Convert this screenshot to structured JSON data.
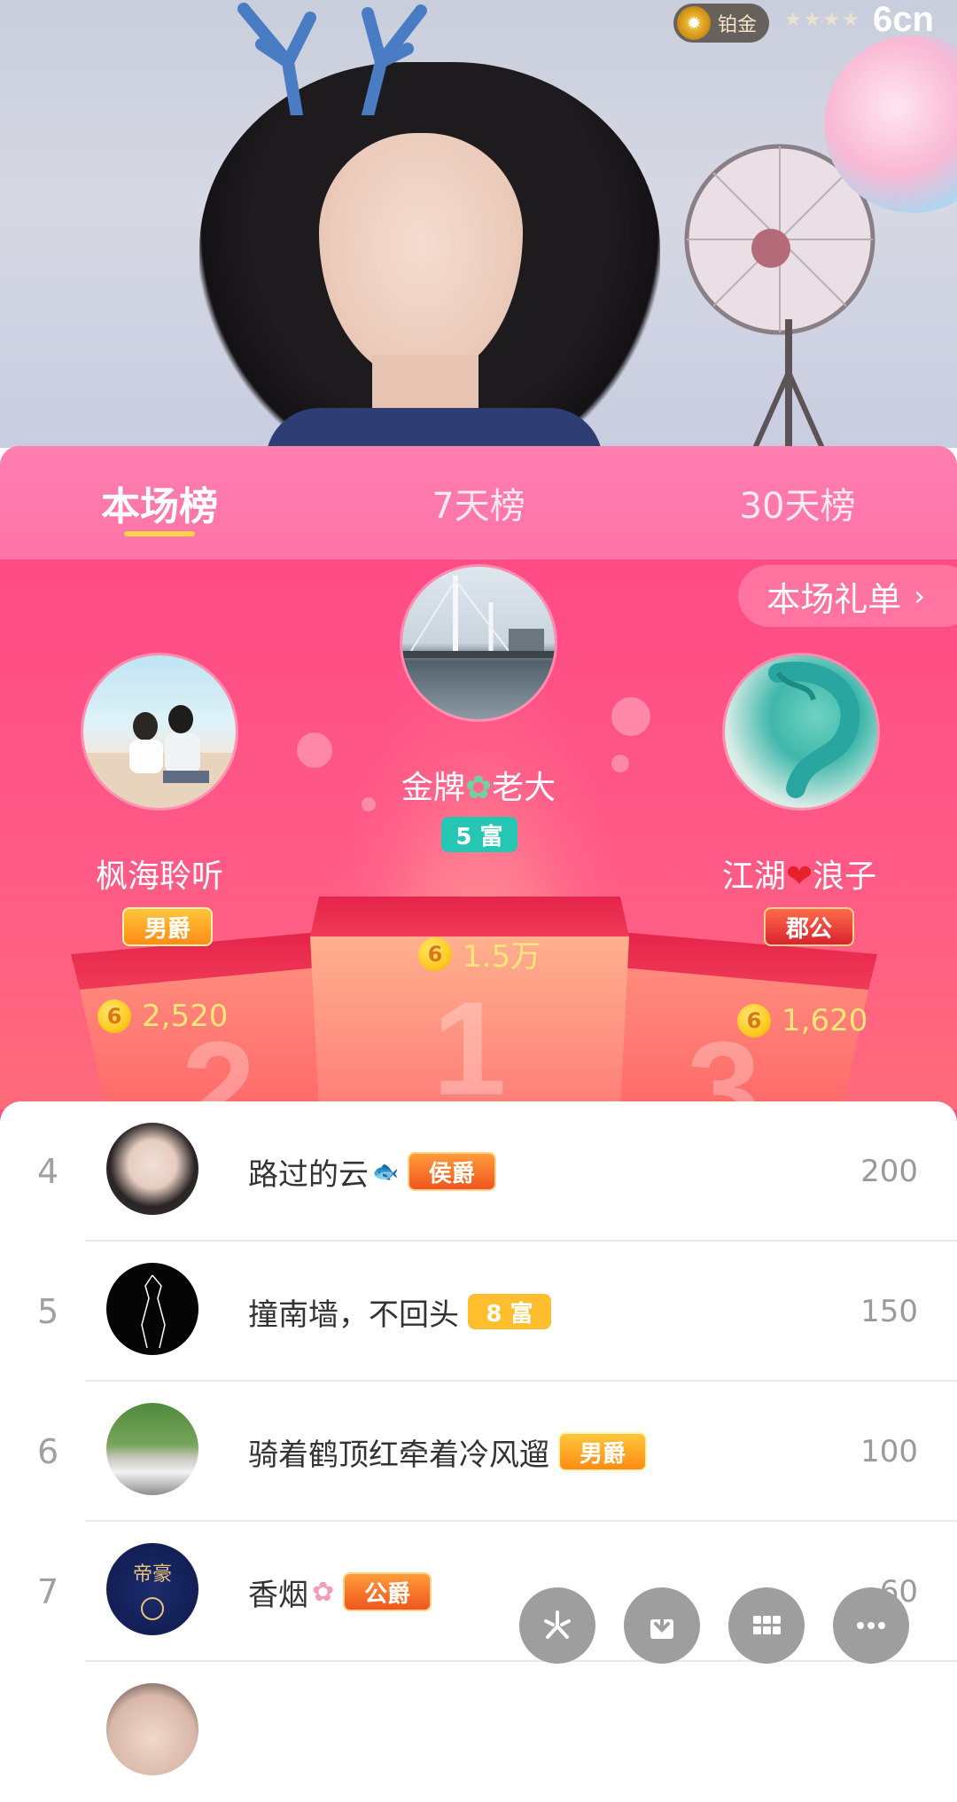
{
  "header": {
    "level_label": "铂金",
    "logo_text": "6cn"
  },
  "tabs": [
    "本场榜",
    "7天榜",
    "30天榜"
  ],
  "gift_list_button": "本场礼单",
  "podium": {
    "first": {
      "name": "金牌",
      "name_suffix": "老大",
      "tag": "5 富",
      "score": "1.5万"
    },
    "second": {
      "name": "枫海聆听",
      "tag": "男爵",
      "score": "2,520"
    },
    "third": {
      "name": "江湖",
      "name_suffix": "浪子",
      "tag": "郡公",
      "score": "1,620"
    }
  },
  "list": [
    {
      "rank": "4",
      "name": "路过的云",
      "tag": "侯爵",
      "score": "200"
    },
    {
      "rank": "5",
      "name": "撞南墙，不回头",
      "tag": "8 富",
      "score": "150"
    },
    {
      "rank": "6",
      "name": "骑着鹤顶红牵着冷风遛",
      "tag": "男爵",
      "score": "100"
    },
    {
      "rank": "7",
      "name": "香烟",
      "tag": "公爵",
      "score": "60"
    }
  ],
  "coin_glyph": "6",
  "colors": {
    "panel_pink": "#ff4e86",
    "tab_bar": "#ff7fb0",
    "active_underline": "#ffd24d",
    "score_yellow": "#ffe57a",
    "fab_gray": "#9e9e9e"
  },
  "icons": {
    "fab1": "sparkle-icon",
    "fab2": "download-icon",
    "fab3": "grid-icon",
    "fab4": "more-icon"
  }
}
